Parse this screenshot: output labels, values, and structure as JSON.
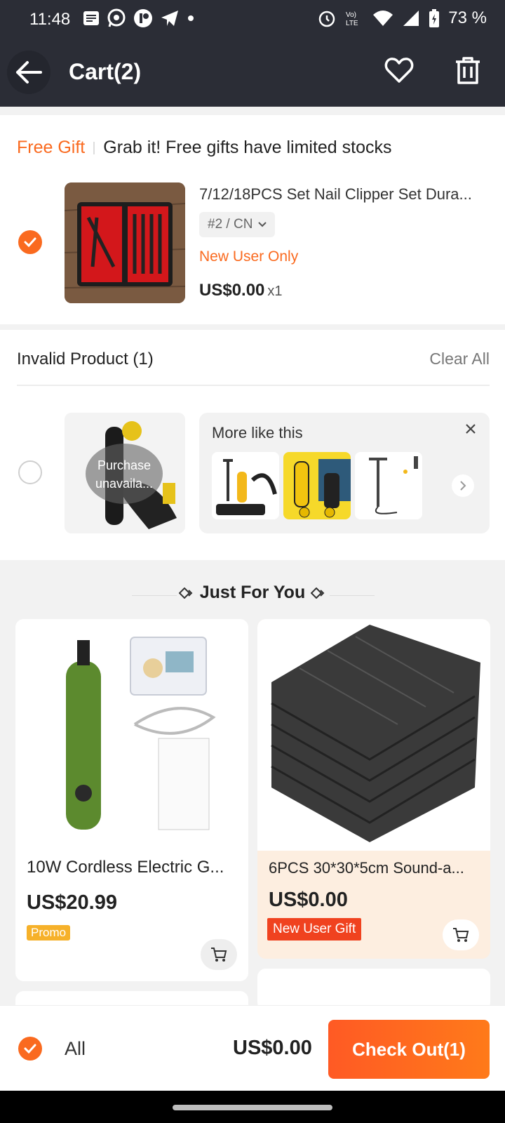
{
  "status_bar": {
    "time": "11:48",
    "battery": "73 %",
    "icons": [
      "notes-icon",
      "whatsapp-icon",
      "app-icon",
      "telegram-icon",
      "dot-icon",
      "alarm-icon",
      "volte-icon",
      "wifi-icon",
      "signal-icon",
      "battery-icon"
    ]
  },
  "header": {
    "title": "Cart(2)",
    "icons": [
      "back-arrow-icon",
      "heart-icon",
      "trash-icon"
    ]
  },
  "free_gift": {
    "label": "Free Gift",
    "message": "Grab it! Free gifts have limited stocks",
    "product_name": "7/12/18PCS Set Nail Clipper Set Dura...",
    "variant": "#2 / CN",
    "badge": "New User Only",
    "price": "US$0.00",
    "quantity": "x1",
    "checked": true
  },
  "invalid": {
    "title": "Invalid Product (1)",
    "clear_all": "Clear All",
    "overlay_text": "Purchase unavaila...",
    "more_like_this": "More like this",
    "checked": false
  },
  "just_for_you": {
    "title": "Just For You",
    "products": [
      {
        "name": "10W Cordless Electric G...",
        "price": "US$20.99",
        "tag": "Promo"
      },
      {
        "name": "6PCS 30*30*5cm Sound-a...",
        "price": "US$0.00",
        "tag": "New User Gift"
      }
    ]
  },
  "bottom_bar": {
    "all_label": "All",
    "total": "US$0.00",
    "checkout": "Check Out(1)"
  },
  "colors": {
    "accent": "#fa6a1f",
    "header_bg": "#2b2d36",
    "checkout_start": "#ff5a24",
    "checkout_end": "#ff7a1a",
    "new_user_gift": "#f0421f",
    "promo": "#f6b12a"
  }
}
